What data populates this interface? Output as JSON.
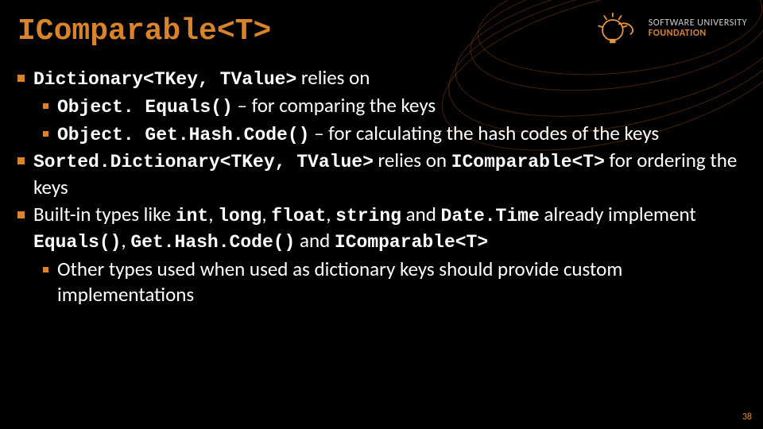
{
  "title": "IComparable<T>",
  "logo": {
    "line1": "SOFTWARE UNIVERSITY",
    "line2": "FOUNDATION"
  },
  "bullets": {
    "b1_a": "Dictionary<TKey, TValue>",
    "b1_b": " relies on",
    "sub1_a": "Object. Equals()",
    "sub1_b": " – for comparing the keys",
    "sub2_a": "Object. Get.Hash.Code()",
    "sub2_b": " – for calculating the hash codes of the keys",
    "b2_a": "Sorted.Dictionary<TKey, TValue>",
    "b2_b": " relies on ",
    "b2_c": "IComparable<T>",
    "b2_d": " for ordering the keys",
    "b3_a": "Built-in types like ",
    "b3_b": "int",
    "b3_c": ", ",
    "b3_d": "long",
    "b3_e": ", ",
    "b3_f": "float",
    "b3_g": ", ",
    "b3_h": "string",
    "b3_i": " and ",
    "b3_j": "Date.Time",
    "b3_k": " already implement ",
    "b3_l": "Equals()",
    "b3_m": ", ",
    "b3_n": "Get.Hash.Code()",
    "b3_o": " and ",
    "b3_p": "IComparable<T>",
    "sub3": "Other types used when used as dictionary keys should provide custom implementations"
  },
  "page_number": "38"
}
